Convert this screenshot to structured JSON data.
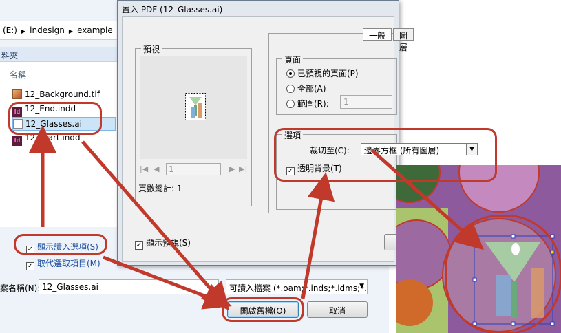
{
  "file_dialog": {
    "address": [
      "(E:)",
      "indesign",
      "example"
    ],
    "nav_header": "料夾",
    "column_name": "名稱",
    "files": [
      {
        "name": "12_Background.tif",
        "type": "tif"
      },
      {
        "name": "12_End.indd",
        "type": "indd"
      },
      {
        "name": "12_Glasses.ai",
        "type": "ai",
        "selected": true
      },
      {
        "name": "12_Start.indd",
        "type": "indd"
      }
    ],
    "show_import_options": {
      "label": "顯示讀入選項(S)",
      "checked": true
    },
    "replace_selected": {
      "label": "取代選取項目(M)",
      "checked": true
    },
    "filename_label": "案名稱(N):",
    "filename_value": "12_Glasses.ai",
    "filetype_value": "可讀入檔案 (*.oam;*.inds;*.idms;*.",
    "open_button": "開啟舊檔(O)",
    "cancel_button": "取消"
  },
  "pdf_dialog": {
    "title": "置入 PDF (12_Glasses.ai)",
    "preview_label": "預視",
    "page_field": "1",
    "total_pages": "頁數總計: 1",
    "show_preview": {
      "label": "顯示預視(S)",
      "checked": true
    },
    "tabs": [
      "一般",
      "圖層"
    ],
    "pages_group": "頁面",
    "radio_preview": "已預視的頁面(P)",
    "radio_all": "全部(A)",
    "radio_range": "範圍(R):",
    "range_value": "1",
    "options_group": "選項",
    "crop_label": "裁切至(C):",
    "crop_value": "邊界方框 (所有圖層)",
    "transparent_bg": {
      "label": "透明背景(T)",
      "checked": true
    }
  },
  "colors": {
    "annotation_red": "#c0392b",
    "canvas_purple": "#8e5a9e"
  }
}
